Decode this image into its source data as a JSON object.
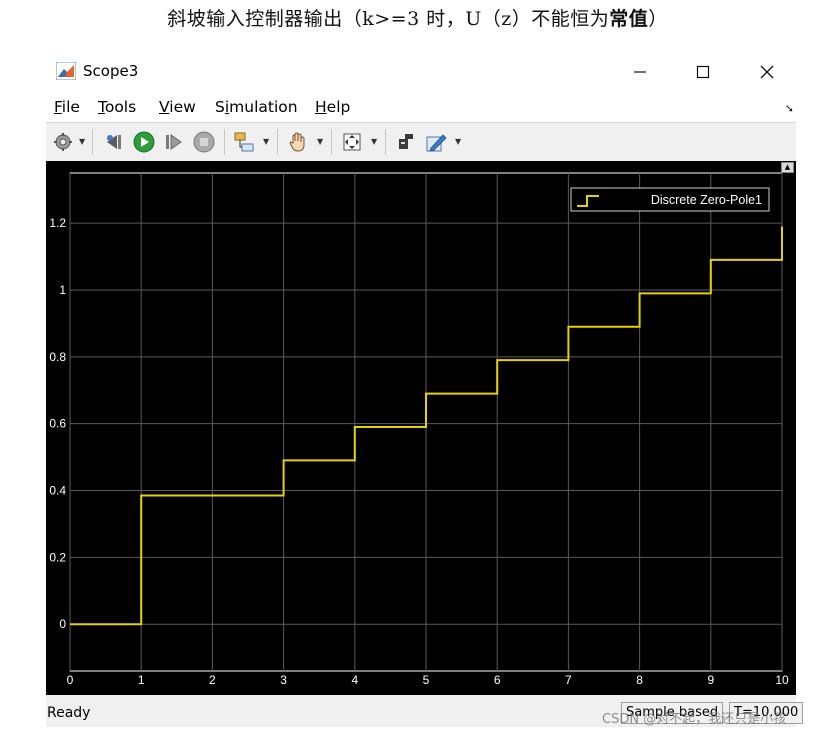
{
  "caption": {
    "normal": "斜坡输入控制器输出（k>=3 时，U（z）不能恒为",
    "bold": "常值",
    "end": "）"
  },
  "window": {
    "title": "Scope3",
    "controls": {
      "minimize": "—",
      "maximize": "☐",
      "close": "✕"
    }
  },
  "menu": [
    {
      "mnemonic": "F",
      "rest": "ile"
    },
    {
      "mnemonic": "T",
      "rest": "ools"
    },
    {
      "mnemonic": "V",
      "rest": "iew"
    },
    {
      "pre": "S",
      "mnemonic": "i",
      "rest": "mulation"
    },
    {
      "mnemonic": "H",
      "rest": "elp"
    }
  ],
  "toolbar": {
    "icons": [
      "gear-icon",
      "step-back-icon",
      "run-icon",
      "step-forward-icon",
      "stop-icon",
      "highlight-block-icon",
      "pan-icon",
      "zoom-fit-icon",
      "cursor-measure-icon",
      "style-icon"
    ]
  },
  "plot": {
    "legend_label": "Discrete Zero-Pole1",
    "line_color": "#e6d200",
    "grid_color": "#5a5a5a",
    "tick_color": "#ffffff"
  },
  "chart_data": {
    "type": "line",
    "step": true,
    "series": [
      {
        "name": "Discrete Zero-Pole1",
        "x": [
          0,
          1,
          2,
          3,
          4,
          5,
          6,
          7,
          8,
          9,
          10
        ],
        "values": [
          0,
          0.385,
          0.385,
          0.49,
          0.59,
          0.69,
          0.79,
          0.89,
          0.99,
          1.09,
          1.19
        ]
      }
    ],
    "xlim": [
      0,
      10
    ],
    "ylim": [
      -0.14,
      1.35
    ],
    "xticks": [
      "0",
      "1",
      "2",
      "3",
      "4",
      "5",
      "6",
      "7",
      "8",
      "9",
      "10"
    ],
    "yticks": [
      {
        "value": 0,
        "label": "0"
      },
      {
        "value": 0.2,
        "label": "0.2"
      },
      {
        "value": 0.4,
        "label": "0.4"
      },
      {
        "value": 0.6,
        "label": "0.6"
      },
      {
        "value": 0.8,
        "label": "0.8"
      },
      {
        "value": 1.0,
        "label": "1"
      },
      {
        "value": 1.2,
        "label": "1.2"
      }
    ],
    "grid": true,
    "legend_position": "top-right"
  },
  "status": {
    "state": "Ready",
    "mode": "Sample based",
    "time": "T=10.000"
  },
  "watermark": "CSDN @对不起，我还只是小孩"
}
